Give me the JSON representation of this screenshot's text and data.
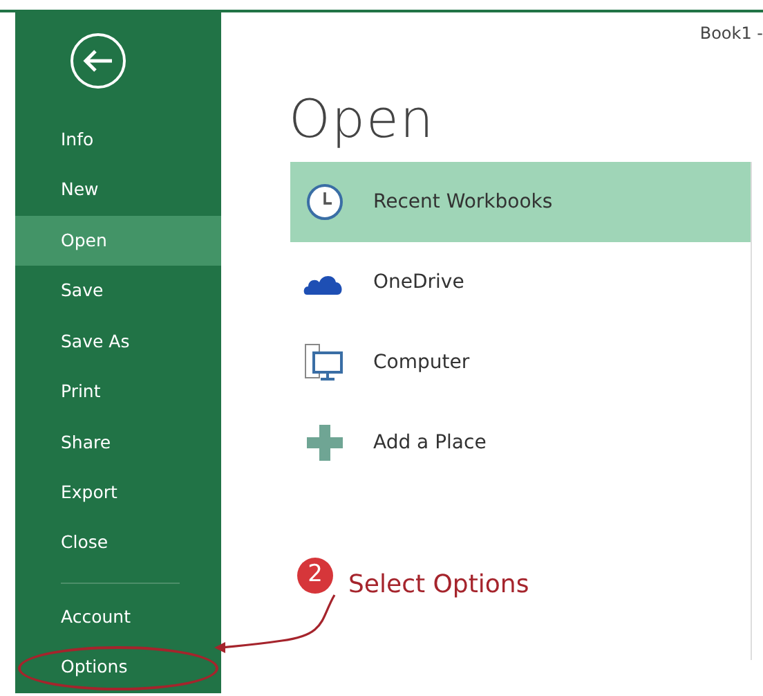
{
  "window": {
    "title": "Book1 -"
  },
  "sidebar": {
    "items": [
      {
        "label": "Info",
        "selected": false,
        "circled": false
      },
      {
        "label": "New",
        "selected": false,
        "circled": false
      },
      {
        "label": "Open",
        "selected": true,
        "circled": false
      },
      {
        "label": "Save",
        "selected": false,
        "circled": false
      },
      {
        "label": "Save As",
        "selected": false,
        "circled": false
      },
      {
        "label": "Print",
        "selected": false,
        "circled": false
      },
      {
        "label": "Share",
        "selected": false,
        "circled": false
      },
      {
        "label": "Export",
        "selected": false,
        "circled": false
      },
      {
        "label": "Close",
        "selected": false,
        "circled": false
      },
      {
        "label": "Account",
        "selected": false,
        "circled": false,
        "divider_before": true
      },
      {
        "label": "Options",
        "selected": false,
        "circled": true
      }
    ]
  },
  "heading": "Open",
  "places": [
    {
      "kind": "clock",
      "label": "Recent Workbooks",
      "selected": true
    },
    {
      "kind": "cloud",
      "label": "OneDrive",
      "selected": false
    },
    {
      "kind": "computer",
      "label": "Computer",
      "selected": false
    },
    {
      "kind": "plus",
      "label": "Add a Place",
      "selected": false
    }
  ],
  "annotation": {
    "step": "2",
    "text": "Select Options"
  }
}
